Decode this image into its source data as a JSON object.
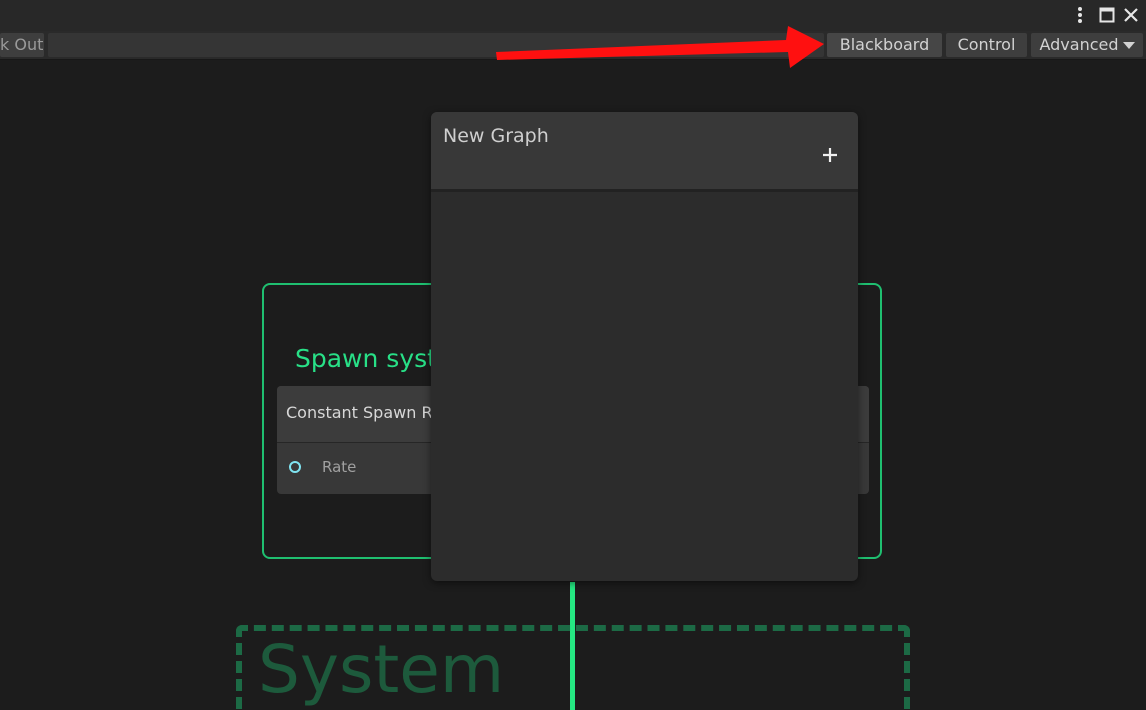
{
  "window": {
    "icons": [
      "kebab-menu-icon",
      "maximize-icon",
      "close-icon"
    ]
  },
  "toolbar": {
    "checkout_label": "k Out",
    "blackboard_label": "Blackboard",
    "control_label": "Control",
    "advanced_label": "Advanced",
    "advanced_icon": "caret-down-icon"
  },
  "blackboard": {
    "title": "New Graph",
    "add_icon": "plus-icon"
  },
  "graph": {
    "spawn_system_title": "Spawn system",
    "block_title": "Constant Spawn Rate",
    "rate_label": "Rate",
    "system_label": "System"
  },
  "colors": {
    "accent_green": "#28e087",
    "annotation_red": "#ff1010",
    "port_cyan": "#7fe3f0"
  }
}
